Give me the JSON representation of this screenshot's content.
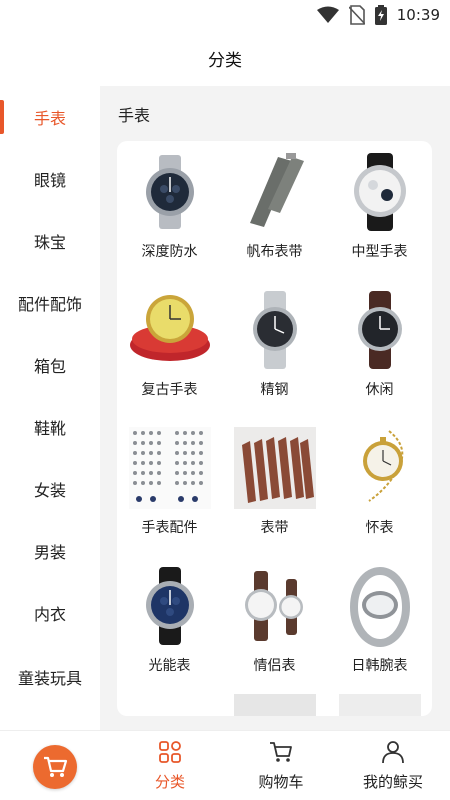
{
  "status_bar": {
    "time": "10:39"
  },
  "header": {
    "title": "分类"
  },
  "sidebar": {
    "items": [
      {
        "label": "手表",
        "active": true
      },
      {
        "label": "眼镜"
      },
      {
        "label": "珠宝"
      },
      {
        "label": "配件配饰"
      },
      {
        "label": "箱包"
      },
      {
        "label": "鞋靴"
      },
      {
        "label": "女装"
      },
      {
        "label": "男装"
      },
      {
        "label": "内衣"
      },
      {
        "label": "童装玩具"
      }
    ]
  },
  "content": {
    "title": "手表",
    "items": [
      {
        "label": "深度防水",
        "icon": "sport-watch-image"
      },
      {
        "label": "帆布表带",
        "icon": "canvas-strap-image"
      },
      {
        "label": "中型手表",
        "icon": "leather-watch-image"
      },
      {
        "label": "复古手表",
        "icon": "vintage-watch-image"
      },
      {
        "label": "精钢",
        "icon": "steel-watch-image"
      },
      {
        "label": "休闲",
        "icon": "casual-watch-image"
      },
      {
        "label": "手表配件",
        "icon": "watch-parts-image"
      },
      {
        "label": "表带",
        "icon": "watch-bands-image"
      },
      {
        "label": "怀表",
        "icon": "pocket-watch-image"
      },
      {
        "label": "光能表",
        "icon": "solar-watch-image"
      },
      {
        "label": "情侣表",
        "icon": "couple-watch-image"
      },
      {
        "label": "日韩腕表",
        "icon": "bangle-watch-image"
      }
    ]
  },
  "bottom_nav": {
    "tabs": [
      {
        "label": "分类",
        "icon": "category-grid-icon",
        "active": true
      },
      {
        "label": "购物车",
        "icon": "cart-icon"
      },
      {
        "label": "我的鲸买",
        "icon": "user-icon"
      }
    ]
  },
  "colors": {
    "accent": "#e8572a",
    "content_bg": "#f3f3f3"
  }
}
